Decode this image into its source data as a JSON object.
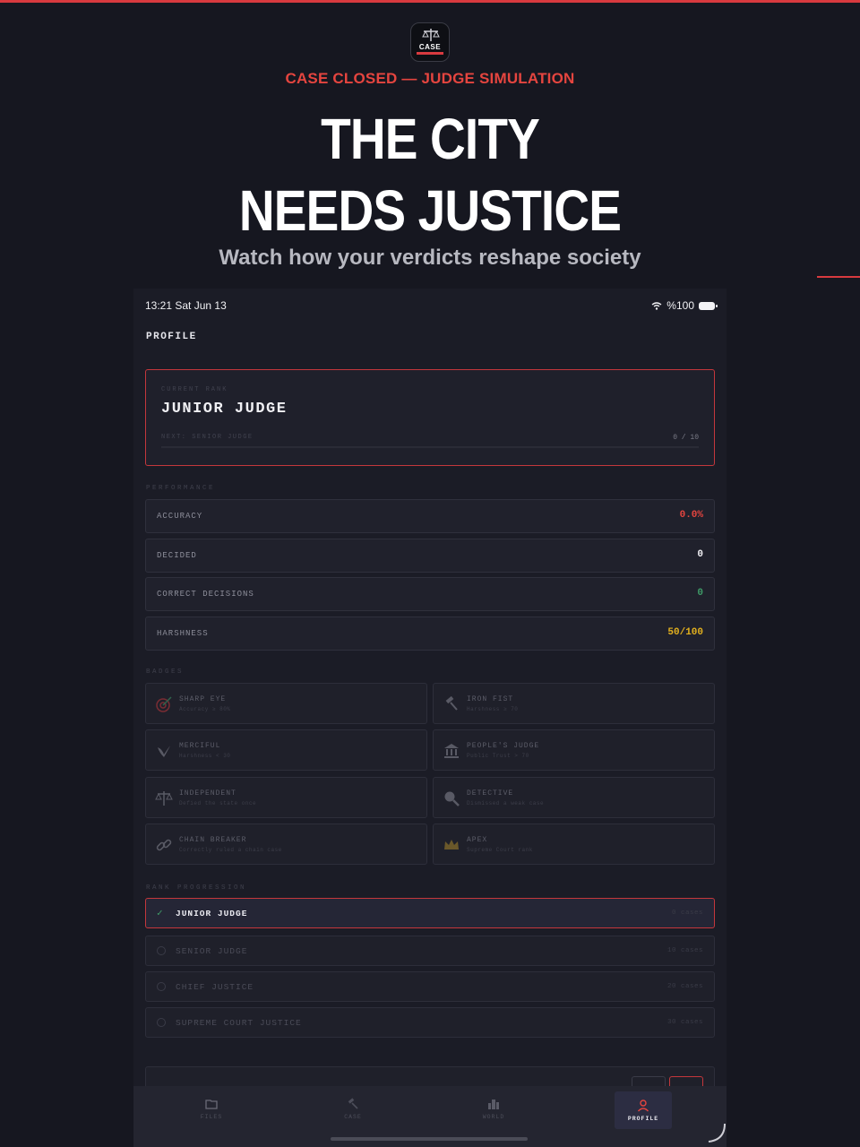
{
  "promo": {
    "kicker": "CASE CLOSED — JUDGE SIMULATION",
    "headline_line1": "THE CITY",
    "headline_line2": "NEEDS JUSTICE",
    "subheadline": "Watch how your verdicts reshape society",
    "app_icon_text": "CASE"
  },
  "status_bar": {
    "time": "13:21  Sat Jun 13",
    "battery": "%100"
  },
  "page_title": "PROFILE",
  "current_rank": {
    "label": "CURRENT RANK",
    "rank": "JUNIOR JUDGE",
    "next_label": "NEXT: SENIOR JUDGE",
    "progress_text": "0 / 10",
    "progress_fraction": 0
  },
  "performance": {
    "label": "PERFORMANCE",
    "stats": [
      {
        "key": "ACCURACY",
        "value": "0.0%",
        "color": "#e5453f"
      },
      {
        "key": "DECIDED",
        "value": "0",
        "color": "#f0f0f4"
      },
      {
        "key": "CORRECT DECISIONS",
        "value": "0",
        "color": "#3f9b68"
      },
      {
        "key": "HARSHNESS",
        "value": "50/100",
        "color": "#e2b01e"
      }
    ]
  },
  "badges": {
    "label": "BADGES",
    "items": [
      {
        "name": "SHARP EYE",
        "desc": "Accuracy ≥ 80%",
        "icon": "target-icon"
      },
      {
        "name": "IRON FIST",
        "desc": "Harshness ≥ 70",
        "icon": "gavel-icon"
      },
      {
        "name": "MERCIFUL",
        "desc": "Harshness < 30",
        "icon": "dove-icon"
      },
      {
        "name": "PEOPLE'S JUDGE",
        "desc": "Public Trust > 70",
        "icon": "courthouse-icon"
      },
      {
        "name": "INDEPENDENT",
        "desc": "Defied the state once",
        "icon": "scales-icon"
      },
      {
        "name": "DETECTIVE",
        "desc": "Dismissed a weak case",
        "icon": "magnifier-icon"
      },
      {
        "name": "CHAIN BREAKER",
        "desc": "Correctly ruled a chain case",
        "icon": "chain-icon"
      },
      {
        "name": "APEX",
        "desc": "Supreme Court rank",
        "icon": "crown-icon"
      }
    ]
  },
  "rank_progression": {
    "label": "RANK PROGRESSION",
    "ranks": [
      {
        "name": "JUNIOR JUDGE",
        "cases": "0 cases",
        "achieved": true
      },
      {
        "name": "SENIOR JUDGE",
        "cases": "10 cases",
        "achieved": false
      },
      {
        "name": "CHIEF JUSTICE",
        "cases": "20 cases",
        "achieved": false
      },
      {
        "name": "SUPREME COURT JUSTICE",
        "cases": "30 cases",
        "achieved": false
      }
    ]
  },
  "tabbar": {
    "tabs": [
      {
        "label": "FILES",
        "icon": "folder-icon"
      },
      {
        "label": "CASE",
        "icon": "gavel-icon"
      },
      {
        "label": "WORLD",
        "icon": "city-icon"
      },
      {
        "label": "PROFILE",
        "icon": "user-icon"
      }
    ]
  }
}
